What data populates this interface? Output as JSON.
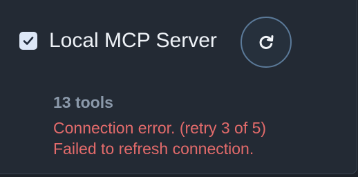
{
  "server": {
    "name": "Local MCP Server",
    "enabled": true,
    "tool_count_label": "13 tools",
    "error_lines": [
      "Connection error. (retry 3 of 5)",
      "Failed to refresh connection."
    ]
  },
  "icons": {
    "checkbox": "checkmark-icon",
    "refresh": "refresh-icon"
  },
  "colors": {
    "panel_background": "#232a34",
    "primary_text": "#eef2f7",
    "muted_text": "#8b99aa",
    "error_text": "#e36b6b",
    "checkbox_fill": "#dde7f7",
    "refresh_ring": "#5b7a99"
  }
}
